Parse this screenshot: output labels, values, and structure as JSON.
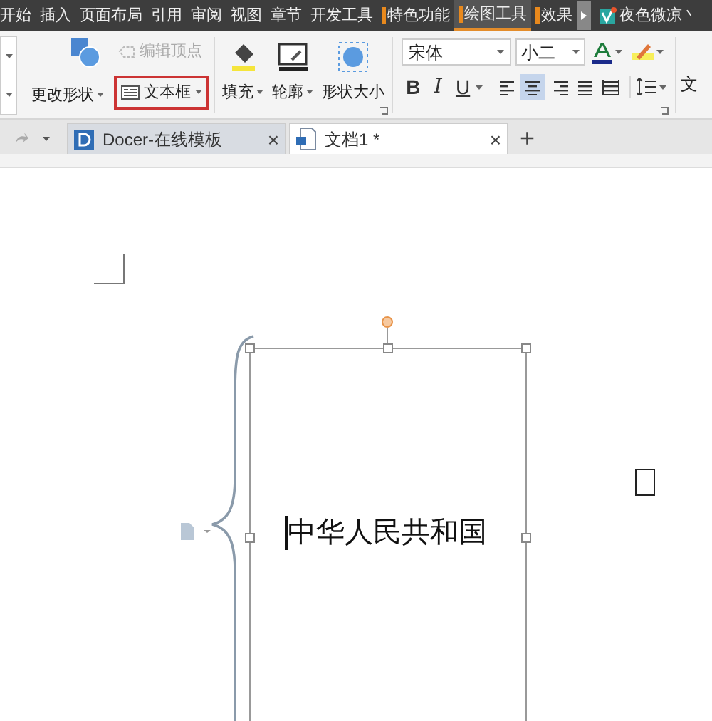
{
  "menu": [
    {
      "label": "开始",
      "marked": false,
      "selected": false
    },
    {
      "label": "插入",
      "marked": false,
      "selected": false
    },
    {
      "label": "页面布局",
      "marked": false,
      "selected": false
    },
    {
      "label": "引用",
      "marked": false,
      "selected": false
    },
    {
      "label": "审阅",
      "marked": false,
      "selected": false
    },
    {
      "label": "视图",
      "marked": false,
      "selected": false
    },
    {
      "label": "章节",
      "marked": false,
      "selected": false
    },
    {
      "label": "开发工具",
      "marked": false,
      "selected": false
    },
    {
      "label": "特色功能",
      "marked": true,
      "selected": false
    },
    {
      "label": "绘图工具",
      "marked": true,
      "selected": true
    },
    {
      "label": "效果",
      "marked": true,
      "selected": false
    }
  ],
  "user": "夜色微凉丶",
  "ribbon": {
    "change_shape": "更改形状",
    "edit_points": {
      "label": "编辑顶点",
      "disabled": true
    },
    "text_box": {
      "label": "文本框",
      "highlighted": true
    },
    "fill": "填充",
    "outline": "轮廓",
    "shape_size": "形状大小",
    "font": "宋体",
    "size": "小二",
    "format": [
      "B",
      "I",
      "U"
    ],
    "align": [
      {
        "kind": "left",
        "selected": false
      },
      {
        "kind": "center",
        "selected": true
      },
      {
        "kind": "right",
        "selected": false
      },
      {
        "kind": "justify",
        "selected": false
      },
      {
        "kind": "distribute",
        "selected": false
      }
    ],
    "more": "文"
  },
  "tabs": [
    {
      "label": "Docer-在线模板",
      "selected": false,
      "close": "×"
    },
    {
      "label": "文档1 *",
      "selected": true,
      "close": "×"
    }
  ],
  "new_tab": "+",
  "document": {
    "text": "中华人民共和国"
  }
}
